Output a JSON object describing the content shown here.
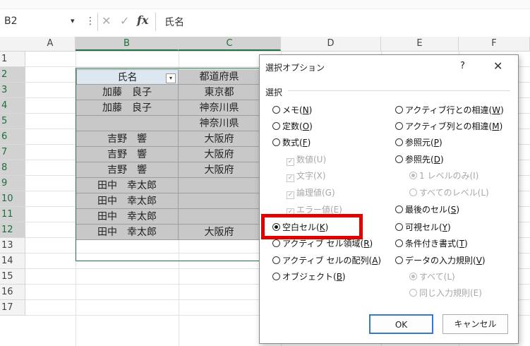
{
  "formula_bar": {
    "name_box": "B2",
    "name_box_arrow": "▾",
    "dots": "⋮",
    "cancel_icon": "✕",
    "enter_icon": "✓",
    "fx_label": "fx",
    "value": "氏名"
  },
  "columns": [
    "A",
    "B",
    "C",
    "D",
    "E",
    "F"
  ],
  "rows": [
    "1",
    "2",
    "3",
    "4",
    "5",
    "6",
    "7",
    "8",
    "9",
    "10",
    "11",
    "12",
    "13",
    "14",
    "15",
    "16",
    "17"
  ],
  "table": {
    "header_b": "氏名",
    "header_c": "都道府県",
    "filter_arrow": "▾",
    "b_values": [
      "加藤　良子",
      "加藤　良子",
      "",
      "吉野　響",
      "吉野　響",
      "吉野　響",
      "田中　幸太郎",
      "田中　幸太郎",
      "田中　幸太郎",
      "田中　幸太郎"
    ],
    "c_values": [
      "東京都",
      "神奈川県",
      "神奈川県",
      "大阪府",
      "大阪府",
      "大阪府",
      "",
      "",
      "",
      "大阪府"
    ]
  },
  "dialog": {
    "title": "選択オプション",
    "help": "?",
    "close": "✕",
    "group_label": "選択",
    "left_options": [
      {
        "label": "メモ(",
        "key": "N",
        "suffix": ")",
        "state": "off"
      },
      {
        "label": "定数(",
        "key": "O",
        "suffix": ")",
        "state": "off"
      },
      {
        "label": "数式(",
        "key": "F",
        "suffix": ")",
        "state": "off"
      },
      {
        "label": "数値(U)",
        "key": "",
        "suffix": "",
        "state": "check-disabled"
      },
      {
        "label": "文字(X)",
        "key": "",
        "suffix": "",
        "state": "check-disabled"
      },
      {
        "label": "論理値(G)",
        "key": "",
        "suffix": "",
        "state": "check-disabled"
      },
      {
        "label": "エラー値(E)",
        "key": "",
        "suffix": "",
        "state": "check-disabled"
      },
      {
        "label": "空白セル(",
        "key": "K",
        "suffix": ")",
        "state": "on"
      },
      {
        "label": "アクティブ セル領域(",
        "key": "R",
        "suffix": ")",
        "state": "off"
      },
      {
        "label": "アクティブ セルの配列(",
        "key": "A",
        "suffix": ")",
        "state": "off"
      },
      {
        "label": "オブジェクト(",
        "key": "B",
        "suffix": ")",
        "state": "off"
      }
    ],
    "right_options": [
      {
        "label": "アクティブ行との相違(",
        "key": "W",
        "suffix": ")",
        "state": "off"
      },
      {
        "label": "アクティブ列との相違(",
        "key": "M",
        "suffix": ")",
        "state": "off"
      },
      {
        "label": "参照元(",
        "key": "P",
        "suffix": ")",
        "state": "off"
      },
      {
        "label": "参照先(",
        "key": "D",
        "suffix": ")",
        "state": "off"
      },
      {
        "label": "1 レベルのみ(I)",
        "key": "",
        "suffix": "",
        "state": "on-disabled"
      },
      {
        "label": "すべてのレベル(L)",
        "key": "",
        "suffix": "",
        "state": "off-disabled"
      },
      {
        "label": "最後のセル(",
        "key": "S",
        "suffix": ")",
        "state": "off"
      },
      {
        "label": "可視セル(",
        "key": "Y",
        "suffix": ")",
        "state": "off"
      },
      {
        "label": "条件付き書式(",
        "key": "T",
        "suffix": ")",
        "state": "off"
      },
      {
        "label": "データの入力規則(",
        "key": "V",
        "suffix": ")",
        "state": "off"
      },
      {
        "label": "すべて(L)",
        "key": "",
        "suffix": "",
        "state": "on-disabled"
      },
      {
        "label": "同じ入力規則(E)",
        "key": "",
        "suffix": "",
        "state": "off-disabled"
      }
    ],
    "ok_label": "OK",
    "cancel_label": "キャンセル",
    "highlight_color": "#e00000"
  }
}
